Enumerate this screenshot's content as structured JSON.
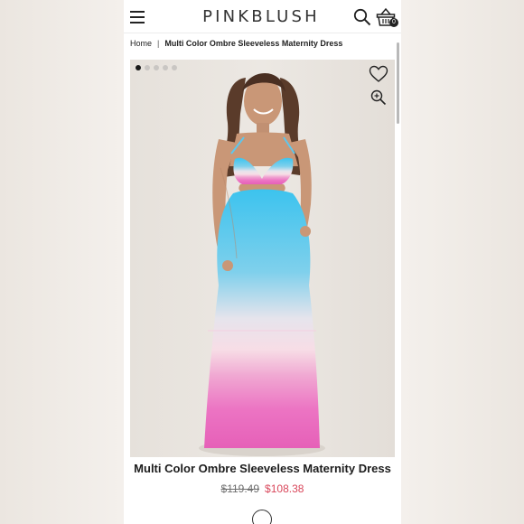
{
  "header": {
    "logo": "PINKBLUSH",
    "cart_count": "0"
  },
  "breadcrumb": {
    "home": "Home",
    "separator": "|",
    "current": "Multi Color Ombre Sleeveless Maternity Dress"
  },
  "gallery": {
    "slide_count": 5,
    "active_slide": 1
  },
  "product": {
    "title": "Multi Color Ombre Sleeveless Maternity Dress",
    "original_price": "$119.49",
    "sale_price": "$108.38"
  },
  "colors": {
    "sale_price": "#d9475b",
    "dress_top": "#3fc1ec",
    "dress_middle": "#f5dde6",
    "dress_bottom": "#ec6fc1"
  },
  "icons": {
    "menu": "hamburger-icon",
    "search": "search-icon",
    "cart": "shopping-basket-icon",
    "wishlist": "heart-icon",
    "zoom": "zoom-in-icon"
  }
}
